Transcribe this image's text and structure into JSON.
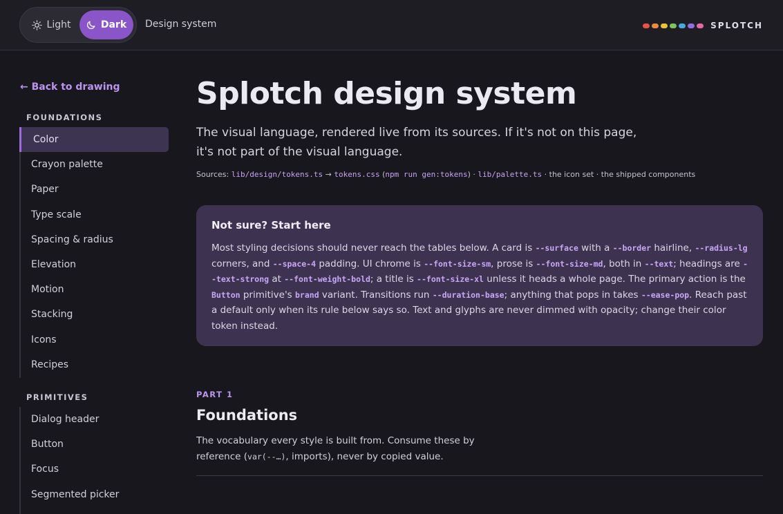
{
  "header": {
    "toggle": {
      "light_label": "Light",
      "dark_label": "Dark",
      "selected": "Dark"
    },
    "breadcrumb": "Design system",
    "brand": {
      "name": "SPLOTCH",
      "dot_colors": [
        "#e5534b",
        "#ee8a3c",
        "#e8c33a",
        "#7cc261",
        "#4aa8e0",
        "#8f6ee0",
        "#e46aa6"
      ]
    }
  },
  "sidebar": {
    "back_link": "← Back to drawing",
    "sections": [
      {
        "title": "FOUNDATIONS",
        "items": [
          "Color",
          "Crayon palette",
          "Paper",
          "Type scale",
          "Spacing & radius",
          "Elevation",
          "Motion",
          "Stacking",
          "Icons",
          "Recipes"
        ],
        "active": "Color"
      },
      {
        "title": "PRIMITIVES",
        "items": [
          "Dialog header",
          "Button",
          "Focus",
          "Segmented picker"
        ]
      }
    ]
  },
  "main": {
    "title": "Splotch design system",
    "lede": "The visual language, rendered live from its sources. If it's not on this page, it's not part of the visual language.",
    "sources": {
      "prefix": "Sources: ",
      "tokens_ts": "lib/design/tokens.ts",
      "arrow": " → ",
      "tokens_css": "tokens.css",
      "open_paren": " (",
      "gen_cmd": "npm run gen:tokens",
      "close_paren": ") · ",
      "palette_ts": "lib/palette.ts",
      "suffix": " · the icon set · the shipped components"
    },
    "callout": {
      "title": "Not sure? Start here",
      "segments": [
        {
          "t": "Most styling decisions should never reach the tables below. A card is "
        },
        {
          "c": "--surface"
        },
        {
          "t": " with a "
        },
        {
          "c": "--border"
        },
        {
          "t": " hairline, "
        },
        {
          "c": "--radius-lg"
        },
        {
          "t": " corners, and "
        },
        {
          "c": "--space-4"
        },
        {
          "t": " padding. UI chrome is "
        },
        {
          "c": "--font-size-sm"
        },
        {
          "t": ", prose is "
        },
        {
          "c": "--font-size-md"
        },
        {
          "t": ", both in "
        },
        {
          "c": "--text"
        },
        {
          "t": "; headings are "
        },
        {
          "c": "--text-strong"
        },
        {
          "t": " at "
        },
        {
          "c": "--font-weight-bold"
        },
        {
          "t": "; a title is "
        },
        {
          "c": "--font-size-xl"
        },
        {
          "t": " unless it heads a whole page. The primary action is the "
        },
        {
          "c": "Button"
        },
        {
          "t": " primitive's "
        },
        {
          "c": "brand"
        },
        {
          "t": " variant. Transitions run "
        },
        {
          "c": "--duration-base"
        },
        {
          "t": "; anything that pops in takes "
        },
        {
          "c": "--ease-pop"
        },
        {
          "t": ". Reach past a default only when its rule below says so. Text and glyphs are never dimmed with opacity; change their color token instead."
        }
      ]
    },
    "part": {
      "label": "PART 1",
      "title": "Foundations",
      "desc_before": "The vocabulary every style is built from. Consume these by reference (",
      "desc_code": "var(--…)",
      "desc_after": ", imports), never by copied value."
    }
  }
}
